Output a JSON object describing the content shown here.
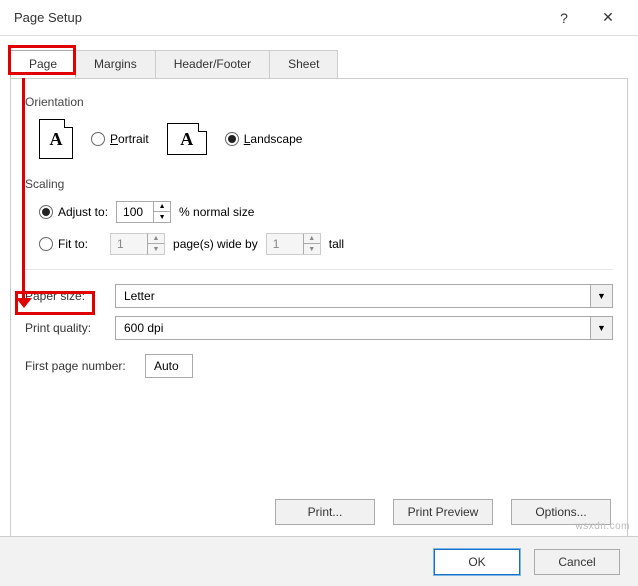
{
  "window": {
    "title": "Page Setup",
    "help": "?",
    "close": "✕"
  },
  "tabs": {
    "page": "Page",
    "margins": "Margins",
    "header_footer": "Header/Footer",
    "sheet": "Sheet"
  },
  "orientation": {
    "label": "Orientation",
    "portrait": "Portrait",
    "landscape": "Landscape",
    "icon_letter": "A",
    "selected": "landscape"
  },
  "scaling": {
    "label": "Scaling",
    "adjust_to": "Adjust to:",
    "adjust_value": "100",
    "adjust_suffix": "% normal size",
    "fit_to": "Fit to:",
    "fit_wide": "1",
    "fit_mid": "page(s) wide by",
    "fit_tall_val": "1",
    "fit_tall": "tall",
    "selected": "adjust"
  },
  "paper_size": {
    "label": "Paper size:",
    "value": "Letter"
  },
  "print_quality": {
    "label": "Print quality:",
    "value": "600 dpi"
  },
  "first_page": {
    "label": "First page number:",
    "value": "Auto"
  },
  "buttons": {
    "print": "Print...",
    "print_preview": "Print Preview",
    "options": "Options...",
    "ok": "OK",
    "cancel": "Cancel"
  },
  "watermark": "wsxdn.com"
}
